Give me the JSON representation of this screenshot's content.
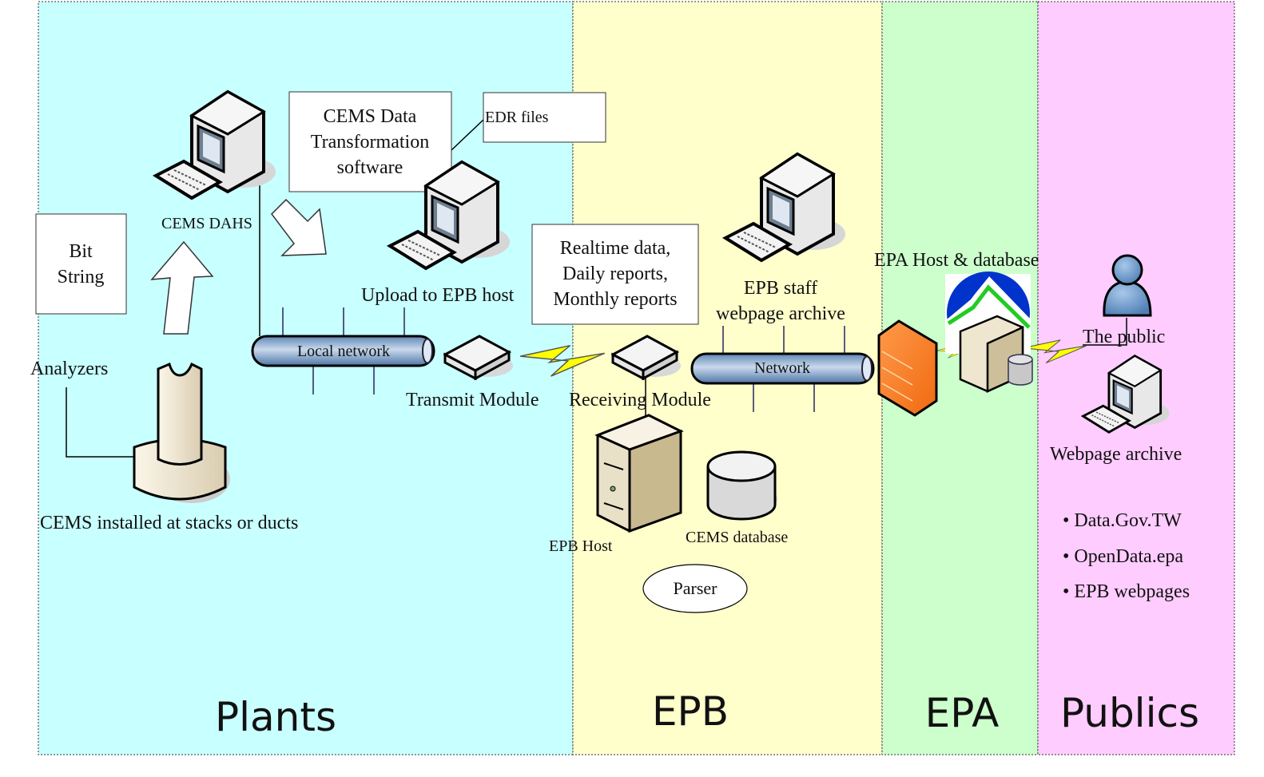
{
  "zones": [
    {
      "label": "Plants",
      "color": "#c8ffff"
    },
    {
      "label": "EPB",
      "color": "#ffffcc"
    },
    {
      "label": "EPA",
      "color": "#ccffcc"
    },
    {
      "label": "Publics",
      "color": "#ffccff"
    }
  ],
  "plants": {
    "bit_string": [
      "Bit",
      "String"
    ],
    "cems_dahs": "CEMS DAHS",
    "transformation_box": [
      "CEMS Data",
      "Transformation",
      "software"
    ],
    "edr_files": "EDR files",
    "upload": "Upload to EPB host",
    "analyzers": "Analyzers",
    "cems_installed": "CEMS installed at stacks or ducts",
    "local_network": "Local network",
    "transmit_module": "Transmit Module"
  },
  "epb": {
    "reports_box": [
      "Realtime data,",
      "Daily reports,",
      "Monthly reports"
    ],
    "receiving_module": "Receiving Module",
    "staff_archive": [
      "EPB staff",
      "webpage archive"
    ],
    "network": "Network",
    "epb_host": "EPB Host",
    "cems_database": "CEMS database",
    "parser": "Parser"
  },
  "epa": {
    "host_db": "EPA Host & database"
  },
  "publics": {
    "the_public": "The public",
    "webpage_archive": "Webpage archive",
    "bullets": [
      "Data.Gov.TW",
      "OpenData.epa",
      "EPB webpages"
    ]
  },
  "icons": [
    "computer-icon",
    "modem-icon",
    "server-icon",
    "database-icon",
    "firewall-icon",
    "user-icon",
    "lightning-icon",
    "epa-logo",
    "arrow-icon"
  ]
}
